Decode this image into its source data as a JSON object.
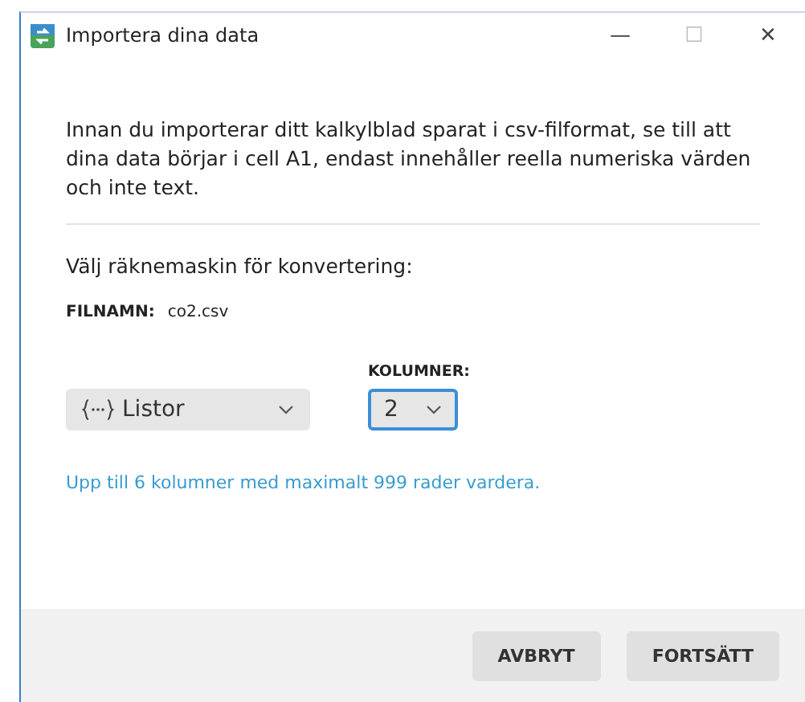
{
  "window": {
    "title": "Importera dina data",
    "controls": [
      "—",
      "☐",
      "✕"
    ]
  },
  "intro": "Innan du importerar ditt kalkylblad sparat i csv-filformat, se till att dina data börjar i cell A1, endast innehåller reella numeriska värden och inte text.",
  "calculator_label": "Välj räknemaskin för konvertering:",
  "filename": {
    "label": "FILNAMN:",
    "value": "co2.csv"
  },
  "list_dropdown": {
    "value": "Listor",
    "focused": false
  },
  "columns": {
    "label": "KOLUMNER:",
    "value": "2",
    "focused": true
  },
  "hint": "Upp till 6 kolumner med maximalt 999 rader vardera.",
  "buttons": [
    "AVBRYT",
    "FORTSÄTT"
  ]
}
